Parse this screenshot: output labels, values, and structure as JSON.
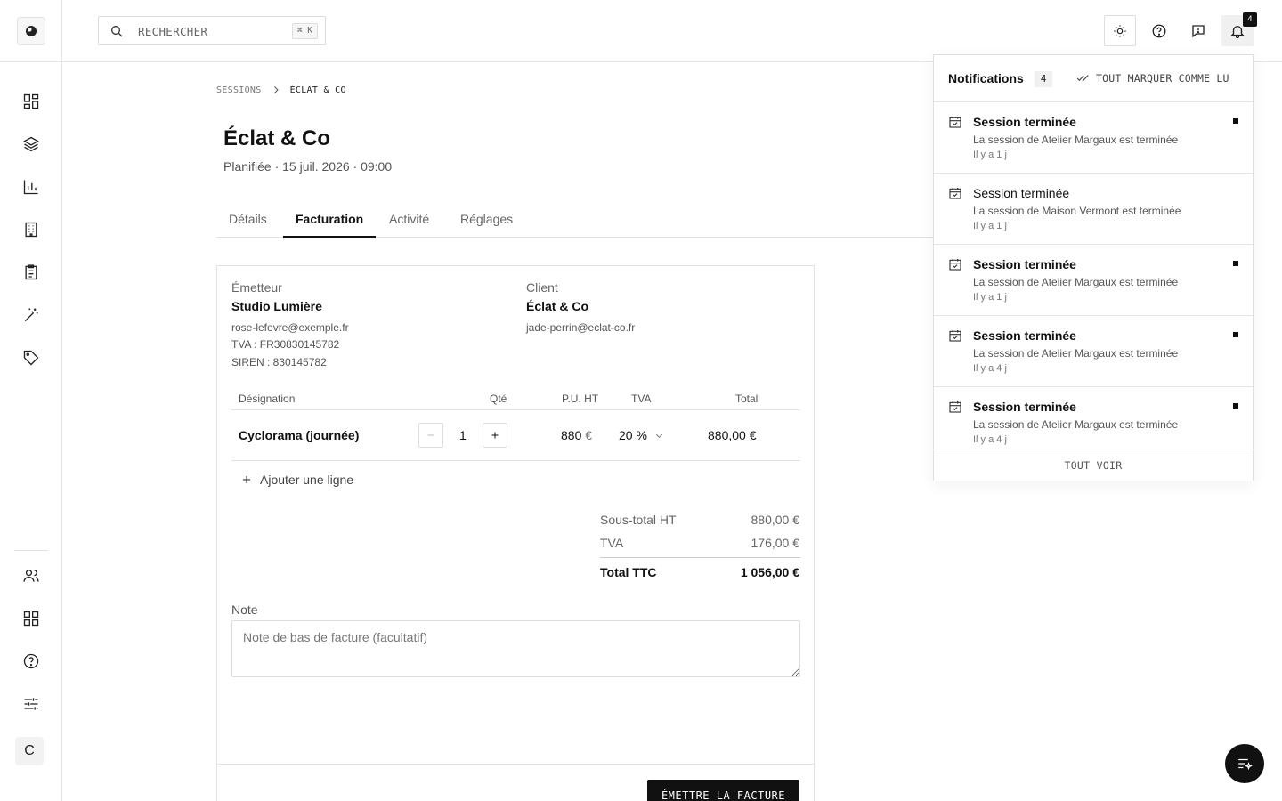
{
  "header": {
    "search": {
      "placeholder": "RECHERCHER",
      "shortcut": "⌘ K"
    },
    "notification_count": "4"
  },
  "sidebar": {
    "items": [
      {
        "icon": "dashboard-icon"
      },
      {
        "icon": "layers-icon"
      },
      {
        "icon": "bar-chart-icon"
      },
      {
        "icon": "building-icon"
      },
      {
        "icon": "clipboard-icon"
      },
      {
        "icon": "magic-wand-icon"
      },
      {
        "icon": "tag-icon"
      }
    ],
    "bottom_items": [
      {
        "icon": "users-icon"
      },
      {
        "icon": "apps-grid-icon"
      },
      {
        "icon": "help-circle-icon"
      },
      {
        "icon": "sliders-icon"
      }
    ],
    "avatar_initial": "C"
  },
  "breadcrumb": {
    "parent": "SESSIONS",
    "current": "ÉCLAT & CO"
  },
  "page": {
    "title": "Éclat & Co",
    "subtitle": "Planifiée · 15 juil. 2026 · 09:00"
  },
  "tabs": [
    {
      "label": "Détails",
      "active": false
    },
    {
      "label": "Facturation",
      "active": true
    },
    {
      "label": "Activité",
      "active": false
    },
    {
      "label": "Réglages",
      "active": false
    }
  ],
  "invoice": {
    "issuer": {
      "label": "Émetteur",
      "name": "Studio Lumière",
      "email": "rose-lefevre@exemple.fr",
      "vat": "TVA : FR30830145782",
      "siren": "SIREN : 830145782"
    },
    "client": {
      "label": "Client",
      "name": "Éclat & Co",
      "email": "jade-perrin@eclat-co.fr"
    },
    "columns": {
      "designation": "Désignation",
      "qty": "Qté",
      "unit_price": "P.U. HT",
      "vat": "TVA",
      "total": "Total"
    },
    "lines": [
      {
        "designation": "Cyclorama (journée)",
        "qty": "1",
        "unit_price": "880",
        "currency": "€",
        "vat": "20 %",
        "total": "880,00 €"
      }
    ],
    "add_line_label": "Ajouter une ligne",
    "totals": {
      "subtotal_label": "Sous-total HT",
      "subtotal": "880,00 €",
      "vat_label": "TVA",
      "vat": "176,00 €",
      "total_label": "Total TTC",
      "total": "1 056,00 €"
    },
    "note": {
      "label": "Note",
      "placeholder": "Note de bas de facture (facultatif)"
    },
    "issue_button": "ÉMETTRE LA FACTURE"
  },
  "notifications": {
    "title": "Notifications",
    "count": "4",
    "mark_all_label": "TOUT MARQUER COMME LU",
    "see_all_label": "TOUT VOIR",
    "items": [
      {
        "title": "Session terminée",
        "desc": "La session de Atelier Margaux est terminée",
        "time": "Il y a 1 j",
        "unread": true
      },
      {
        "title": "Session terminée",
        "desc": "La session de Maison Vermont est terminée",
        "time": "Il y a 1 j",
        "unread": false
      },
      {
        "title": "Session terminée",
        "desc": "La session de Atelier Margaux est terminée",
        "time": "Il y a 1 j",
        "unread": true
      },
      {
        "title": "Session terminée",
        "desc": "La session de Atelier Margaux est terminée",
        "time": "Il y a 4 j",
        "unread": true
      },
      {
        "title": "Session terminée",
        "desc": "La session de Atelier Margaux est terminée",
        "time": "Il y a 4 j",
        "unread": true
      }
    ]
  },
  "colors": {
    "accent": "#111111",
    "border": "#e2e2e2",
    "muted_text": "#666666"
  }
}
